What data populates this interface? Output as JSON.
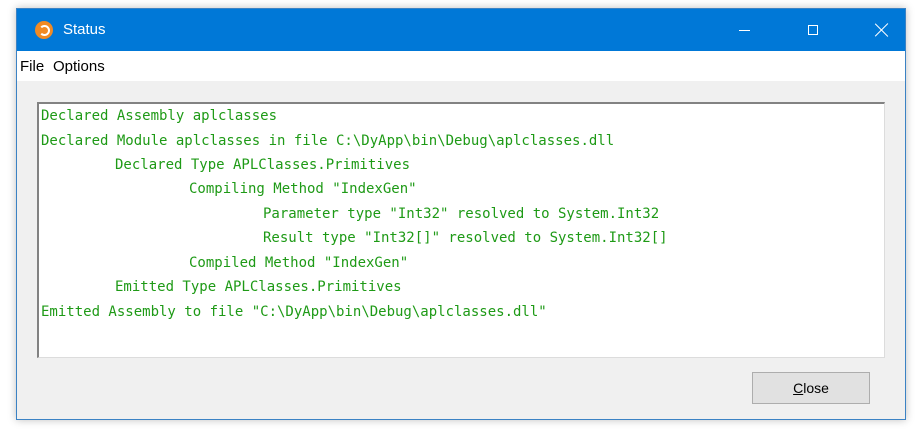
{
  "window": {
    "title": "Status",
    "app_icon": "dyalog-logo-icon"
  },
  "titlebar_controls": {
    "minimize_icon": "minimize-icon",
    "maximize_icon": "maximize-icon",
    "close_icon": "close-icon"
  },
  "menu": {
    "file": "File",
    "options": "Options"
  },
  "log": {
    "lines": [
      "Declared Assembly aplclasses",
      "Declared Module aplclasses in file C:\\DyApp\\bin\\Debug\\aplclasses.dll",
      "Declared Type APLClasses.Primitives",
      "Compiling Method \"IndexGen\"",
      "Parameter type \"Int32\" resolved to System.Int32",
      "Result type \"Int32[]\" resolved to System.Int32[]",
      "Compiled Method \"IndexGen\"",
      "Emitted Type APLClasses.Primitives",
      "Emitted Assembly to file \"C:\\DyApp\\bin\\Debug\\aplclasses.dll\""
    ],
    "text_color": "#1e9a16"
  },
  "buttons": {
    "close_underlined": "C",
    "close_rest": "lose"
  },
  "colors": {
    "titlebar": "#0078d7",
    "dialog_background": "#f0f0f0"
  }
}
